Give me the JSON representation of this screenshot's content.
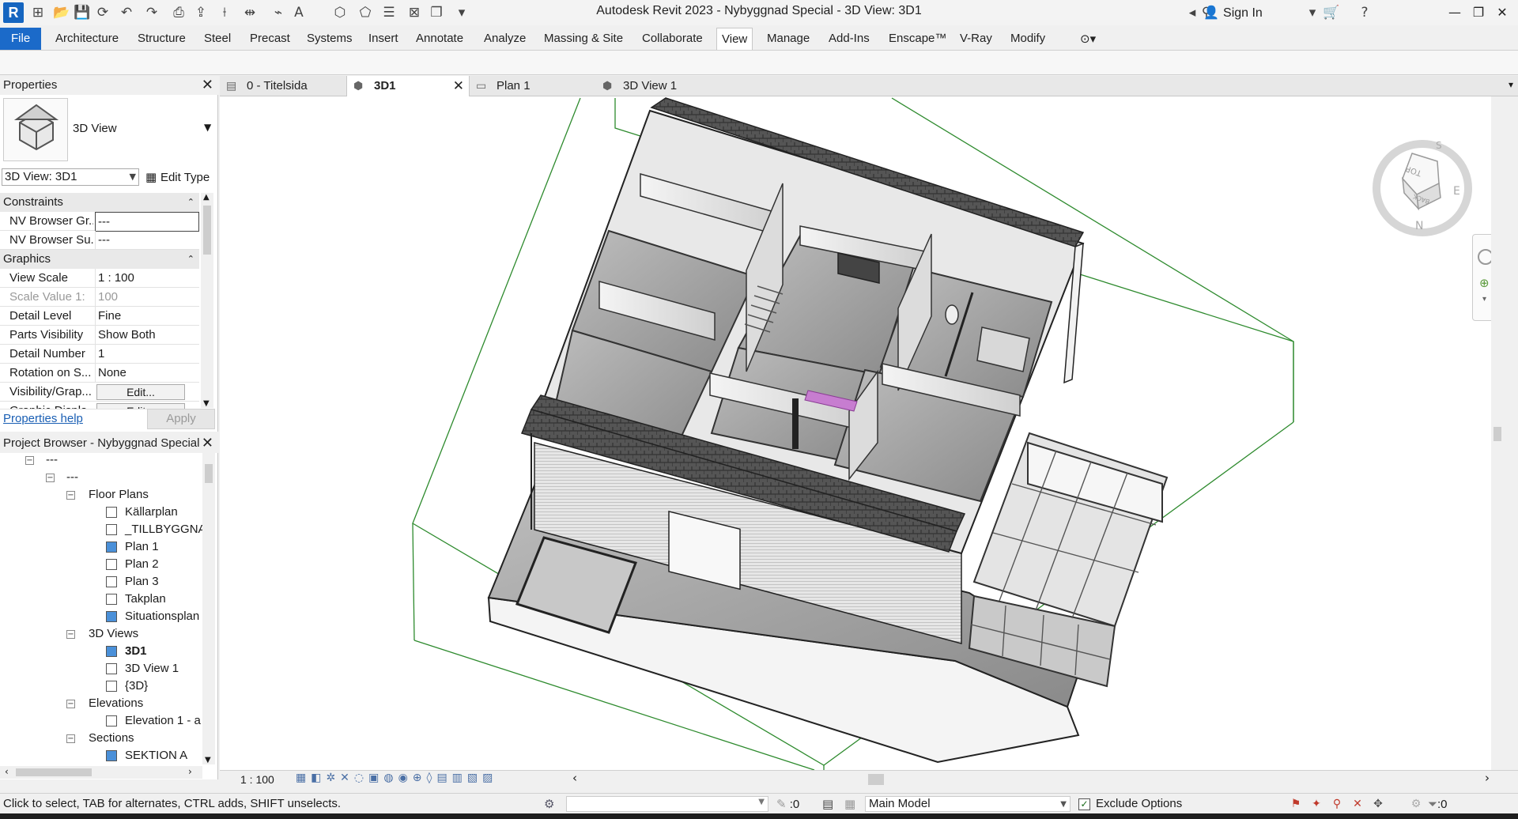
{
  "window": {
    "title": "Autodesk Revit 2023 - Nybyggnad Special - 3D View: 3D1",
    "sign_in": "Sign In",
    "logo": "R"
  },
  "ribbon": {
    "tabs": [
      "File",
      "Architecture",
      "Structure",
      "Steel",
      "Precast",
      "Systems",
      "Insert",
      "Annotate",
      "Analyze",
      "Massing & Site",
      "Collaborate",
      "View",
      "Manage",
      "Add-Ins",
      "Enscape™",
      "V-Ray",
      "Modify"
    ],
    "active_tab": "View"
  },
  "properties": {
    "header": "Properties",
    "type_name": "3D View",
    "view_select": "3D View: 3D1",
    "edit_type": "Edit Type",
    "groups": [
      {
        "name": "Constraints",
        "rows": [
          {
            "name": "NV Browser Gr...",
            "value": "---"
          },
          {
            "name": "NV Browser Su...",
            "value": "---"
          }
        ]
      },
      {
        "name": "Graphics",
        "rows": [
          {
            "name": "View Scale",
            "value": "1 : 100"
          },
          {
            "name": "Scale Value   1:",
            "value": "100"
          },
          {
            "name": "Detail Level",
            "value": "Fine"
          },
          {
            "name": "Parts Visibility",
            "value": "Show Both"
          },
          {
            "name": "Detail Number",
            "value": "1"
          },
          {
            "name": "Rotation on S...",
            "value": "None"
          },
          {
            "name": "Visibility/Grap...",
            "value": "Edit..."
          },
          {
            "name": "Graphic Displa...",
            "value": "Edit..."
          }
        ]
      }
    ],
    "help_link": "Properties help",
    "apply": "Apply"
  },
  "project_browser": {
    "header": "Project Browser - Nybyggnad Special",
    "root_a": "---",
    "root_b": "---",
    "floor_plans": "Floor Plans",
    "floor_plan_items": [
      "Källarplan",
      "_TILLBYGGNAD",
      "Plan 1",
      "Plan 2",
      "Plan 3",
      "Takplan",
      "Situationsplan"
    ],
    "views_3d": "3D Views",
    "view_3d_items": [
      "3D1",
      "3D View 1",
      "{3D}"
    ],
    "elevations": "Elevations",
    "elevation_items": [
      "Elevation 1 - a"
    ],
    "sections": "Sections",
    "section_items": [
      "SEKTION A"
    ]
  },
  "view_tabs": [
    "0 - Titelsida",
    "3D1",
    "Plan 1",
    "3D View 1"
  ],
  "view_tab_active": "3D1",
  "viewcube": {
    "top": "TOP",
    "back": "BACK",
    "north": "N",
    "south": "S",
    "east": "E"
  },
  "view_control": {
    "scale": "1 : 100"
  },
  "status": {
    "message": "Click to select, TAB for alternates, CTRL adds, SHIFT unselects.",
    "workset": "Main Model",
    "exclude_options": "Exclude Options",
    "zero_a": ":0",
    "zero_b": ":0"
  }
}
